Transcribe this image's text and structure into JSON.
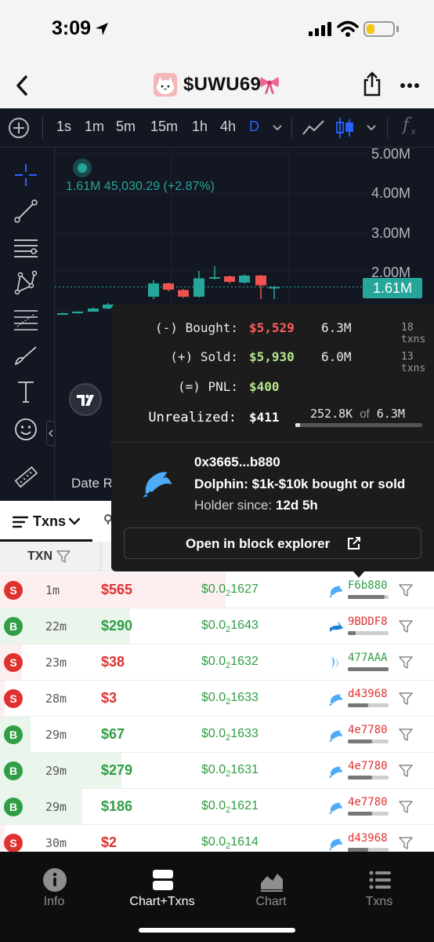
{
  "status_bar": {
    "time": "3:09"
  },
  "header": {
    "title": "$UWU69"
  },
  "chart_toolbar": {
    "timeframes": [
      {
        "label": "1s",
        "active": false
      },
      {
        "label": "1m",
        "active": false
      },
      {
        "label": "5m",
        "active": false
      },
      {
        "label": "15m",
        "active": false
      },
      {
        "label": "1h",
        "active": false
      },
      {
        "label": "4h",
        "active": false
      },
      {
        "label": "D",
        "active": true
      }
    ],
    "fx_label": "f"
  },
  "chart": {
    "legend_value": "1.61M",
    "legend_ohlc": "45,030.29 (+2.87%)",
    "price_axis": [
      "5.00M",
      "4.00M",
      "3.00M",
      "2.00M"
    ],
    "last_price_tag": "1.61M",
    "date_range_label": "Date R"
  },
  "chart_data": {
    "type": "candlestick",
    "y_unit": "M",
    "ylim": [
      0.5,
      5.0
    ],
    "last_price": 1.61,
    "candles": [
      {
        "open": 0.92,
        "close": 0.94,
        "high": 0.95,
        "low": 0.91
      },
      {
        "open": 0.94,
        "close": 0.98,
        "high": 0.99,
        "low": 0.93
      },
      {
        "open": 0.98,
        "close": 1.06,
        "high": 1.09,
        "low": 0.97
      },
      {
        "open": 1.06,
        "close": 1.16,
        "high": 1.2,
        "low": 1.04
      },
      {
        "open": 1.36,
        "close": 1.7,
        "high": 1.78,
        "low": 1.3
      },
      {
        "open": 1.7,
        "close": 1.54,
        "high": 1.72,
        "low": 1.5
      },
      {
        "open": 1.53,
        "close": 1.36,
        "high": 1.56,
        "low": 1.33
      },
      {
        "open": 1.36,
        "close": 1.83,
        "high": 2.02,
        "low": 1.34
      },
      {
        "open": 1.83,
        "close": 1.86,
        "high": 2.14,
        "low": 1.8
      },
      {
        "open": 1.88,
        "close": 1.74,
        "high": 1.9,
        "low": 1.7
      },
      {
        "open": 1.72,
        "close": 1.9,
        "high": 1.93,
        "low": 1.7
      },
      {
        "open": 1.9,
        "close": 1.65,
        "high": 1.92,
        "low": 1.3
      },
      {
        "open": 1.58,
        "close": 1.61,
        "high": 1.63,
        "low": 1.3
      }
    ]
  },
  "popover": {
    "bought_label": "(-) Bought:",
    "bought_usd": "$5,529",
    "bought_amount": "6.3M",
    "bought_txns": "18 txns",
    "sold_label": "(+) Sold:",
    "sold_usd": "$5,930",
    "sold_amount": "6.0M",
    "sold_txns": "13 txns",
    "pnl_label": "(=) PNL:",
    "pnl_usd": "$400",
    "unrealized_label": "Unrealized:",
    "unrealized_usd": "$411",
    "holding_amount": "252.8K",
    "holding_of": "of",
    "holding_total": "6.3M",
    "holding_fraction": 0.04,
    "address": "0x3665...b880",
    "tier_name": "Dolphin:",
    "tier_range": "$1k-$10k bought or sold",
    "holder_since_label": "Holder since:",
    "holder_since_value": "12d 5h",
    "explorer_button": "Open in block explorer"
  },
  "tabs": {
    "txns_label": "Txns"
  },
  "table": {
    "header_txn": "TXN",
    "rows": [
      {
        "side": "S",
        "age": "1m",
        "usd": "$565",
        "price_a": "$0.0",
        "price_sub": "2",
        "price_b": "1627",
        "maker": "F6b880",
        "maker_color": "#2f9e44",
        "icon": "dolphin-icon",
        "bar": 0.9,
        "flow": 0.52
      },
      {
        "side": "B",
        "age": "22m",
        "usd": "$290",
        "price_a": "$0.0",
        "price_sub": "2",
        "price_b": "1643",
        "maker": "9BDDF8",
        "maker_color": "#e03131",
        "icon": "shark-icon",
        "bar": 0.2,
        "flow": 0.3
      },
      {
        "side": "S",
        "age": "23m",
        "usd": "$38",
        "price_a": "$0.0",
        "price_sub": "2",
        "price_b": "1632",
        "maker": "477AAA",
        "maker_color": "#2f9e44",
        "icon": "whale-icon",
        "bar": 1.0,
        "flow": 0.05
      },
      {
        "side": "S",
        "age": "28m",
        "usd": "$3",
        "price_a": "$0.0",
        "price_sub": "2",
        "price_b": "1633",
        "maker": "d43968",
        "maker_color": "#e03131",
        "icon": "dolphin-icon",
        "bar": 0.5,
        "flow": 0.01
      },
      {
        "side": "B",
        "age": "29m",
        "usd": "$67",
        "price_a": "$0.0",
        "price_sub": "2",
        "price_b": "1633",
        "maker": "4e7780",
        "maker_color": "#e03131",
        "icon": "dolphin-icon",
        "bar": 0.6,
        "flow": 0.07
      },
      {
        "side": "B",
        "age": "29m",
        "usd": "$279",
        "price_a": "$0.0",
        "price_sub": "2",
        "price_b": "1631",
        "maker": "4e7780",
        "maker_color": "#e03131",
        "icon": "dolphin-icon",
        "bar": 0.6,
        "flow": 0.28
      },
      {
        "side": "B",
        "age": "29m",
        "usd": "$186",
        "price_a": "$0.0",
        "price_sub": "2",
        "price_b": "1621",
        "maker": "4e7780",
        "maker_color": "#e03131",
        "icon": "dolphin-icon",
        "bar": 0.6,
        "flow": 0.19
      },
      {
        "side": "S",
        "age": "30m",
        "usd": "$2",
        "price_a": "$0.0",
        "price_sub": "2",
        "price_b": "1614",
        "maker": "d43968",
        "maker_color": "#e03131",
        "icon": "dolphin-icon",
        "bar": 0.5,
        "flow": 0.01
      }
    ]
  },
  "bottom_nav": {
    "items": [
      {
        "label": "Info",
        "icon": "info-icon",
        "active": false
      },
      {
        "label": "Chart+Txns",
        "icon": "split-view-icon",
        "active": true
      },
      {
        "label": "Chart",
        "icon": "area-chart-icon",
        "active": false
      },
      {
        "label": "Txns",
        "icon": "list-icon",
        "active": false
      }
    ]
  },
  "colors": {
    "buy": "#2f9e44",
    "sell": "#e03131",
    "chart_bg": "#131722",
    "up": "#26a69a",
    "down": "#ef5350",
    "accent": "#2962ff"
  }
}
